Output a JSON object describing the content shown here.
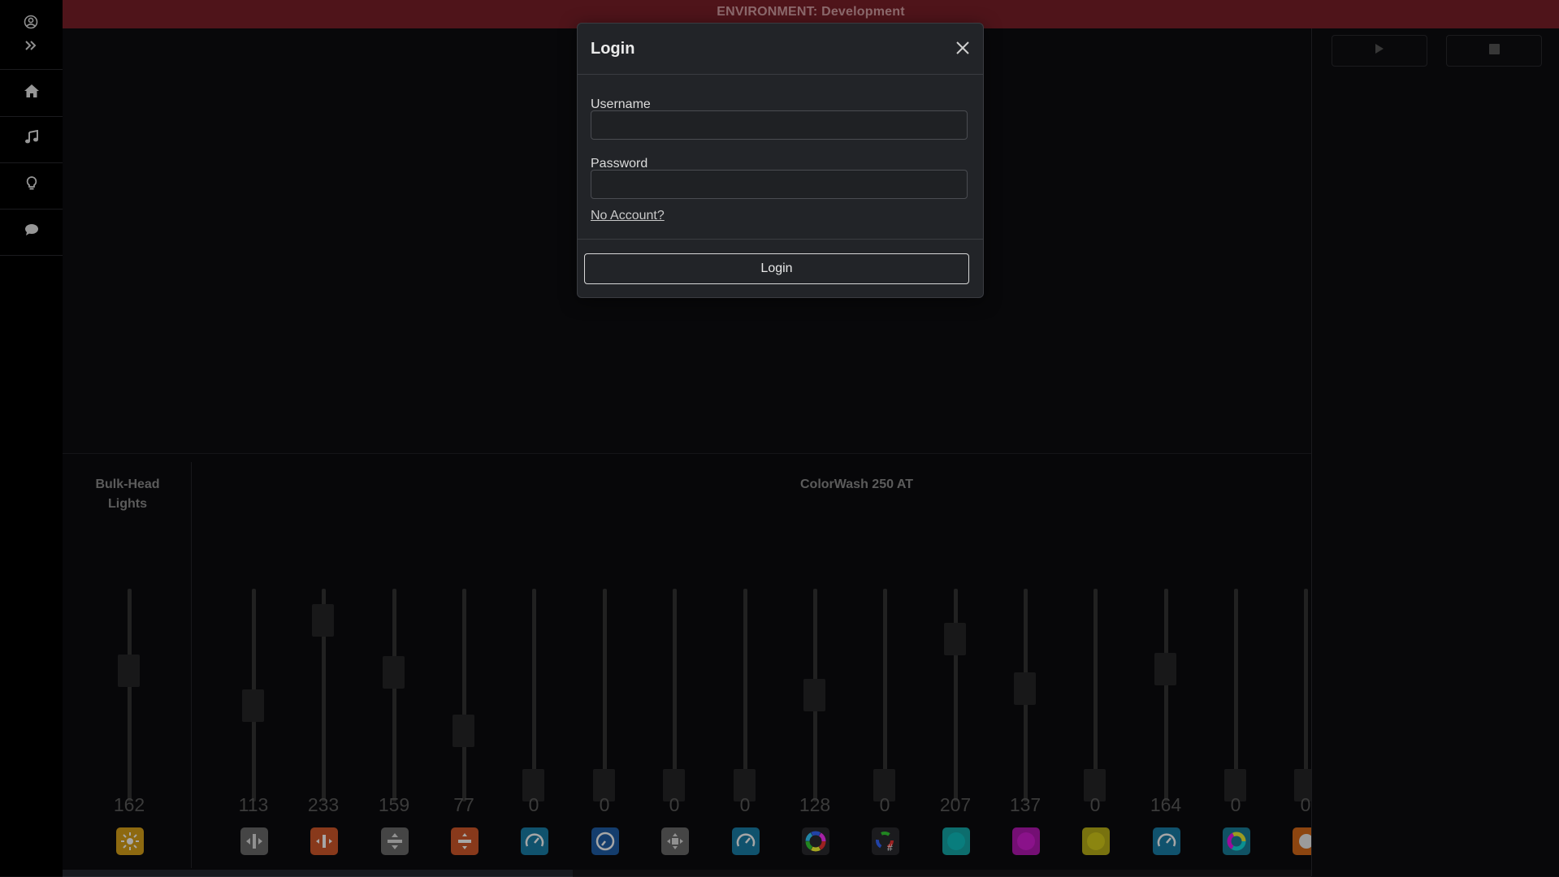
{
  "environment": {
    "label": "ENVIRONMENT:",
    "value": "Development"
  },
  "sidebar": {
    "items": [
      {
        "icon": "user-circle-icon"
      },
      {
        "icon": "expand-icon"
      },
      {
        "icon": "home-icon"
      },
      {
        "icon": "music-note-icon"
      },
      {
        "icon": "lightbulb-icon"
      },
      {
        "icon": "chat-icon"
      }
    ]
  },
  "transport": {
    "play_icon": "play-icon",
    "stop_icon": "stop-icon"
  },
  "groups": [
    {
      "title_line1": "Bulk-Head",
      "title_line2": "Lights"
    },
    {
      "title_line1": "ColorWash 250 AT",
      "title_line2": ""
    }
  ],
  "faders": [
    {
      "value": "162",
      "level": 0.635,
      "icon": "dimmer-icon",
      "color": "#d9a21a"
    },
    {
      "value": "113",
      "level": 0.443,
      "icon": "pan-icon",
      "color": "#6a6a6a"
    },
    {
      "value": "233",
      "level": 0.914,
      "icon": "pan-fine-icon",
      "color": "#d2582a"
    },
    {
      "value": "159",
      "level": 0.624,
      "icon": "tilt-icon",
      "color": "#6a6a6a"
    },
    {
      "value": "77",
      "level": 0.302,
      "icon": "tilt-fine-icon",
      "color": "#d2582a"
    },
    {
      "value": "0",
      "level": 0,
      "icon": "speed-icon",
      "color": "#1a7fa8"
    },
    {
      "value": "0",
      "level": 0,
      "icon": "speed-alt-icon",
      "color": "#1f5fa8"
    },
    {
      "value": "0",
      "level": 0,
      "icon": "move-icon",
      "color": "#6a6a6a"
    },
    {
      "value": "0",
      "level": 0,
      "icon": "speed-icon",
      "color": "#1a7fa8"
    },
    {
      "value": "128",
      "level": 0.502,
      "icon": "color-wheel-icon",
      "color": "#2a2a2e"
    },
    {
      "value": "0",
      "level": 0,
      "icon": "color-wheel-fine-icon",
      "color": "#2a2a2e"
    },
    {
      "value": "207",
      "level": 0.812,
      "icon": "cyan-icon",
      "color": "#14a8a8"
    },
    {
      "value": "137",
      "level": 0.537,
      "icon": "magenta-icon",
      "color": "#b218b2"
    },
    {
      "value": "0",
      "level": 0,
      "icon": "yellow-icon",
      "color": "#b8b018"
    },
    {
      "value": "164",
      "level": 0.643,
      "icon": "speed-icon",
      "color": "#1a7fa8"
    },
    {
      "value": "0",
      "level": 0,
      "icon": "cmy-icon",
      "color": "#1a7f9a"
    },
    {
      "value": "0",
      "level": 0,
      "icon": "gobo-icon",
      "color": "#d86a1a"
    }
  ],
  "login_modal": {
    "title": "Login",
    "username_label": "Username",
    "username_value": "",
    "password_label": "Password",
    "password_value": "",
    "no_account_link": "No Account?",
    "login_button": "Login"
  }
}
